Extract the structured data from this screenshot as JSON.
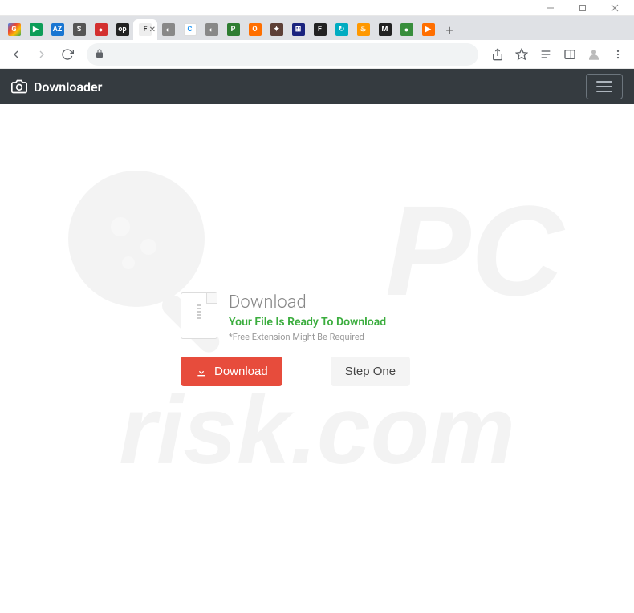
{
  "window": {
    "title": ""
  },
  "tabs": [
    {
      "icon": "G",
      "cls": "fg"
    },
    {
      "icon": "▶",
      "cls": "fgr"
    },
    {
      "icon": "AZ",
      "cls": "faz"
    },
    {
      "icon": "S",
      "cls": "fs"
    },
    {
      "icon": "●",
      "cls": "fred"
    },
    {
      "icon": "op",
      "cls": "fop"
    },
    {
      "icon": "F",
      "cls": "ff",
      "active": true
    },
    {
      "icon": "◐",
      "cls": "fglobe"
    },
    {
      "icon": "C",
      "cls": "fc"
    },
    {
      "icon": "◐",
      "cls": "fglobe"
    },
    {
      "icon": "P",
      "cls": "fp"
    },
    {
      "icon": "O",
      "cls": "fo"
    },
    {
      "icon": "✦",
      "cls": "fsh"
    },
    {
      "icon": "⊞",
      "cls": "feu"
    },
    {
      "icon": "F",
      "cls": "ffb"
    },
    {
      "icon": "↻",
      "cls": "fre"
    },
    {
      "icon": "♨",
      "cls": "ffl"
    },
    {
      "icon": "M",
      "cls": "fm"
    },
    {
      "icon": "●",
      "cls": "fgm"
    },
    {
      "icon": "▶",
      "cls": "for"
    }
  ],
  "page": {
    "brand": "Downloader",
    "download_heading": "Download",
    "ready_text": "Your File Is Ready To Download",
    "note_text": "*Free Extension Might Be Required",
    "download_button": "Download",
    "step_button": "Step One"
  }
}
